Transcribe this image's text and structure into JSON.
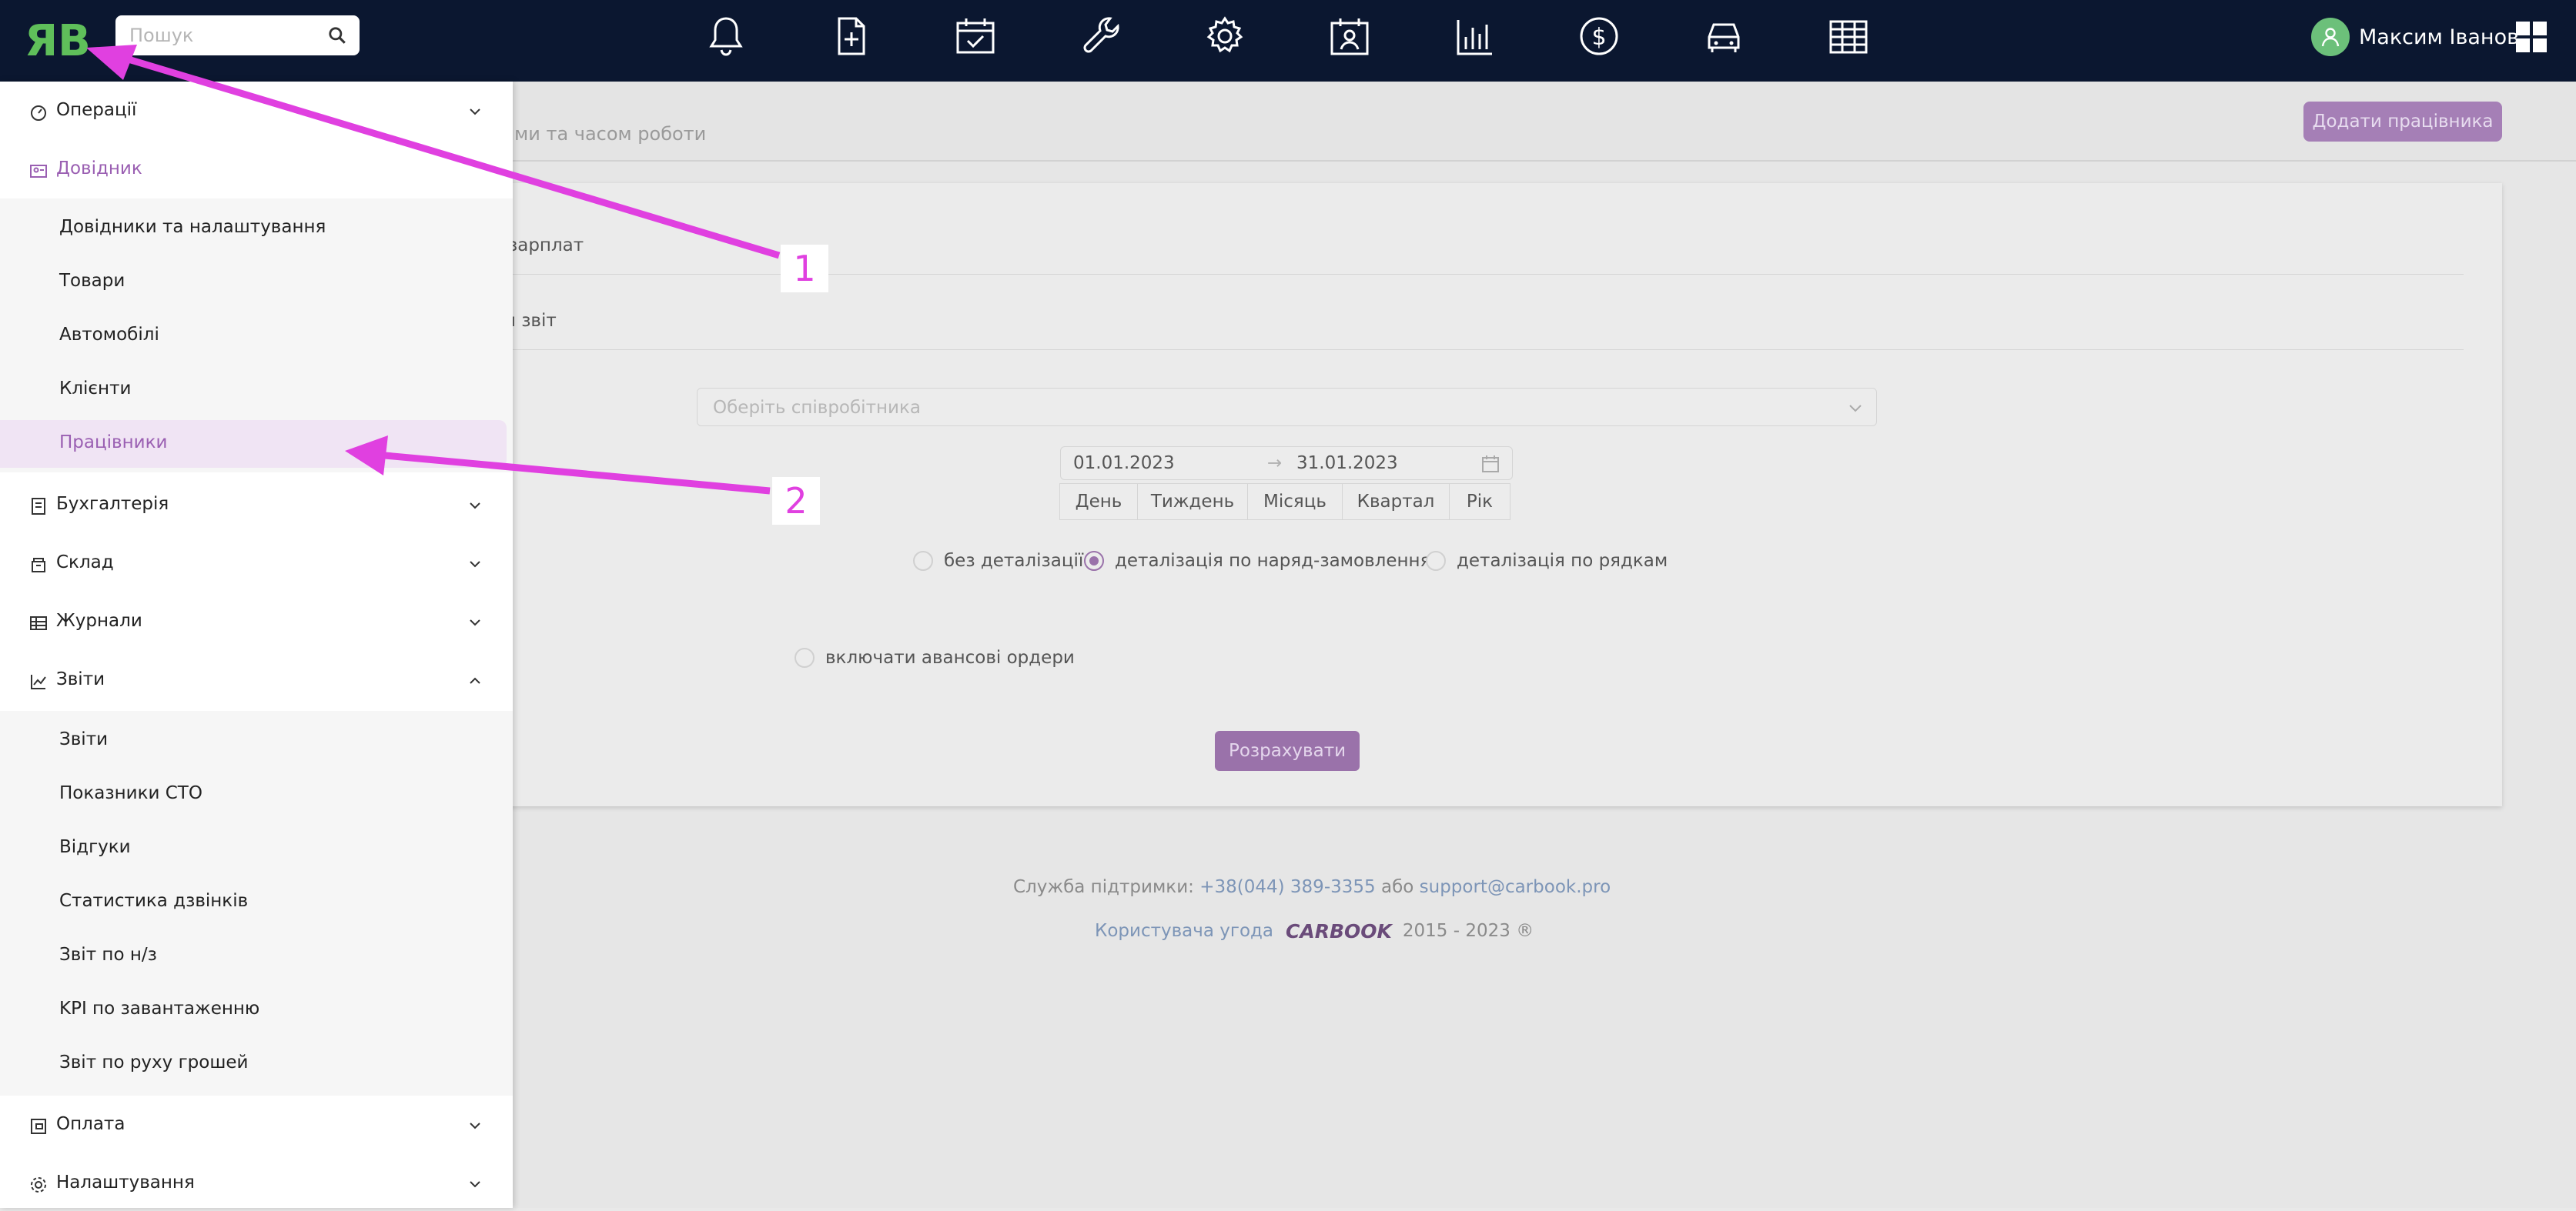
{
  "topbar": {
    "logo_text": "ЯB",
    "search": {
      "placeholder": "Пошук",
      "value": ""
    },
    "nav_icons": [
      "bell-icon",
      "new-document-icon",
      "calendar-check-icon",
      "wrench-icon",
      "gear-icon",
      "calendar-person-icon",
      "bar-chart-icon",
      "dollar-icon",
      "car-icon",
      "table-icon"
    ],
    "user_name": "Максим Іванов"
  },
  "page": {
    "subtitle": "ям, замовленнями та часом роботи",
    "add_button": "Додати працівника",
    "row1": "зарплат",
    "row2": "ий звіт",
    "employee_placeholder": "Оберіть співробітника",
    "date_from": "01.01.2023",
    "date_to": "31.01.2023",
    "date_arrow": "→",
    "periods": [
      "День",
      "Тиждень",
      "Місяць",
      "Квартал",
      "Рік"
    ],
    "radios": [
      {
        "label": "без деталізації",
        "checked": false
      },
      {
        "label": "деталізація по наряд-замовленням",
        "checked": true
      },
      {
        "label": "деталізація по рядкам",
        "checked": false
      }
    ],
    "checkbox_label": "включати авансові ордери",
    "calculate_button": "Розрахувати"
  },
  "footer": {
    "support_label": "Служба підтримки:",
    "phone": "+38(044) 389-3355",
    "or": "або",
    "email": "support@carbook.pro",
    "agreement": "Користувача угода",
    "brand": "CARBOOK",
    "years": "2015 - 2023 ®"
  },
  "sidebar": {
    "sections": [
      {
        "label": "Операції",
        "icon": "dashboard-icon",
        "expanded": false
      },
      {
        "label": "Довідник",
        "icon": "directory-icon",
        "expanded": true,
        "active": true
      },
      {
        "label": "Бухгалтерія",
        "icon": "accounting-icon",
        "expanded": false
      },
      {
        "label": "Склад",
        "icon": "warehouse-icon",
        "expanded": false
      },
      {
        "label": "Журнали",
        "icon": "journal-table-icon",
        "expanded": false
      },
      {
        "label": "Звіти",
        "icon": "line-chart-icon",
        "expanded": true
      },
      {
        "label": "Оплата",
        "icon": "payment-icon",
        "expanded": false
      },
      {
        "label": "Налаштування",
        "icon": "settings-icon",
        "expanded": false
      }
    ],
    "directory_items": [
      "Довідники та налаштування",
      "Товари",
      "Автомобілі",
      "Клієнти",
      "Працівники"
    ],
    "selected_item": "Працівники",
    "report_items": [
      "Звіти",
      "Показники СТО",
      "Відгуки",
      "Статистика дзвінків",
      "Звіт по н/з",
      "KPI по завантаженню",
      "Звіт по руху грошей"
    ]
  },
  "annotations": {
    "callout_1": "1",
    "callout_2": "2",
    "arrow_color": "#e040e0"
  }
}
